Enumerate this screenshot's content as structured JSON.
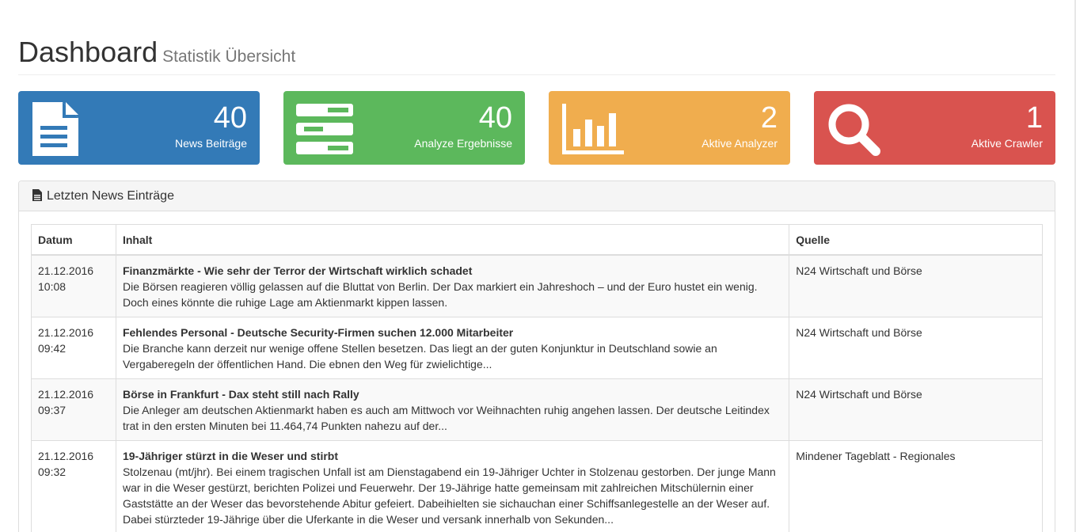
{
  "header": {
    "title": "Dashboard",
    "subtitle": "Statistik Übersicht"
  },
  "stats": [
    {
      "value": "40",
      "label": "News Beiträge",
      "icon": "file-text-icon",
      "color": "#337ab7"
    },
    {
      "value": "40",
      "label": "Analyze Ergebnisse",
      "icon": "server-icon",
      "color": "#5cb85c"
    },
    {
      "value": "2",
      "label": "Aktive Analyzer",
      "icon": "bar-chart-icon",
      "color": "#f0ad4e"
    },
    {
      "value": "1",
      "label": "Aktive Crawler",
      "icon": "search-icon",
      "color": "#d9534f"
    }
  ],
  "news_panel": {
    "heading": "Letzten News Einträge",
    "columns": {
      "date": "Datum",
      "content": "Inhalt",
      "source": "Quelle"
    },
    "rows": [
      {
        "date": "21.12.2016",
        "time": "10:08",
        "title": "Finanzmärkte -  Wie sehr der Terror der Wirtschaft wirklich schadet",
        "text": "Die Börsen reagieren völlig gelassen auf die Bluttat von Berlin. Der Dax markiert ein Jahreshoch – und der Euro hustet ein wenig. Doch eines könnte die ruhige Lage am Aktienmarkt kippen lassen.",
        "source": "N24 Wirtschaft und Börse"
      },
      {
        "date": "21.12.2016",
        "time": "09:42",
        "title": "Fehlendes Personal -  Deutsche Security-Firmen suchen 12.000 Mitarbeiter",
        "text": "Die Branche kann derzeit nur wenige offene Stellen besetzen. Das liegt an der guten Konjunktur in Deutschland sowie an Vergaberegeln der öffentlichen Hand. Die ebnen den Weg für zwielichtige...",
        "source": "N24 Wirtschaft und Börse"
      },
      {
        "date": "21.12.2016",
        "time": "09:37",
        "title": "Börse in Frankfurt -  Dax steht still nach Rally",
        "text": "Die Anleger am deutschen Aktienmarkt haben es auch am Mittwoch vor Weihnachten ruhig angehen lassen. Der deutsche Leitindex trat in den ersten Minuten bei 11.464,74 Punkten nahezu auf der...",
        "source": "N24 Wirtschaft und Börse"
      },
      {
        "date": "21.12.2016",
        "time": "09:32",
        "title": "19-Jähriger stürzt in die Weser und stirbt",
        "text": "Stolzenau (mt/jhr). Bei einem tragischen Unfall ist am Dienstagabend ein 19-Jähriger Uchter in Stolzenau gestorben. Der junge Mann war in die Weser gestürzt, berichten Polizei und Feuerwehr. Der 19-Jährige hatte gemeinsam mit zahlreichen Mitschülernin einer Gaststätte an der Weser das bevorstehende Abitur gefeiert. Dabeihielten sie sichauchan einer Schiffsanlegestelle an der Weser auf. Dabei stürzteder 19-Jährige über die Uferkante in die Weser und versank innerhalb von Sekunden...",
        "source": "Mindener Tageblatt - Regionales"
      }
    ]
  }
}
